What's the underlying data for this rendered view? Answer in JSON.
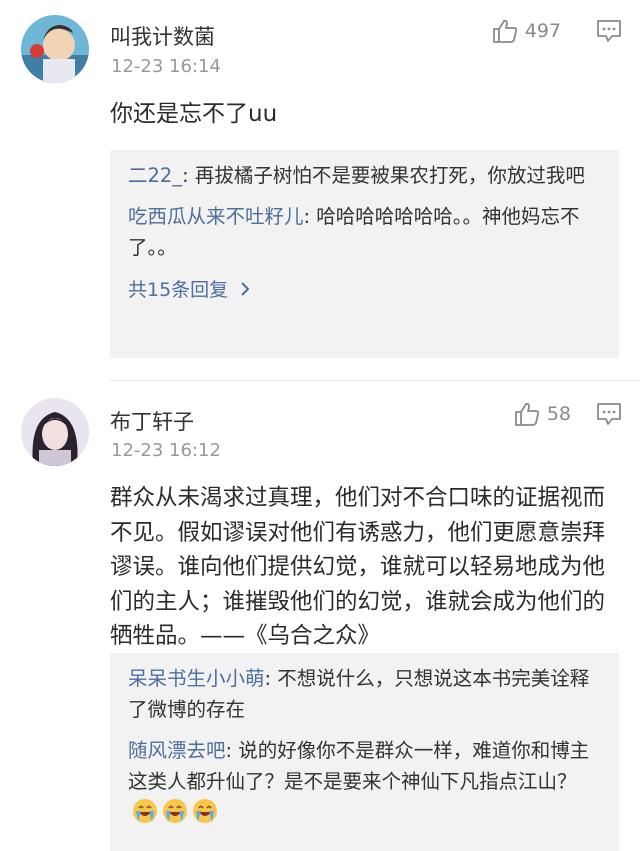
{
  "comments": [
    {
      "username": "叫我计数菌",
      "time": "12-23 16:14",
      "likes": "497",
      "content": "你还是忘不了uu",
      "replies": [
        {
          "name": "二22_",
          "text": ": 再拔橘子树怕不是要被果农打死，你放过我吧"
        },
        {
          "name": "吃西瓜从来不吐籽儿",
          "text": ": 哈哈哈哈哈哈哈。。神他妈忘不了。。"
        }
      ],
      "more_label": "共15条回复"
    },
    {
      "username": "布丁轩子",
      "time": "12-23 16:12",
      "likes": "58",
      "content": "群众从未渴求过真理，他们对不合口味的证据视而不见。假如谬误对他们有诱惑力，他们更愿意崇拜谬误。谁向他们提供幻觉，谁就可以轻易地成为他们的主人；谁摧毁他们的幻觉，谁就会成为他们的牺牲品。——《乌合之众》",
      "replies": [
        {
          "name": "呆呆书生小小萌",
          "text": ": 不想说什么，只想说这本书完美诠释了微博的存在"
        },
        {
          "name": "随风漂去吧",
          "text": ": 说的好像你不是群众一样，难道你和博主这类人都升仙了？是不是要来个神仙下凡指点江山？"
        }
      ]
    }
  ],
  "icons": {
    "like": "thumbs-up-icon",
    "reply": "comment-icon",
    "chevron": "chevron-right-icon",
    "emoji": "crying-laughing-emoji"
  },
  "colors": {
    "link": "#4e6f9c",
    "reply_bg": "#f2f2f2",
    "meta": "#999999"
  }
}
